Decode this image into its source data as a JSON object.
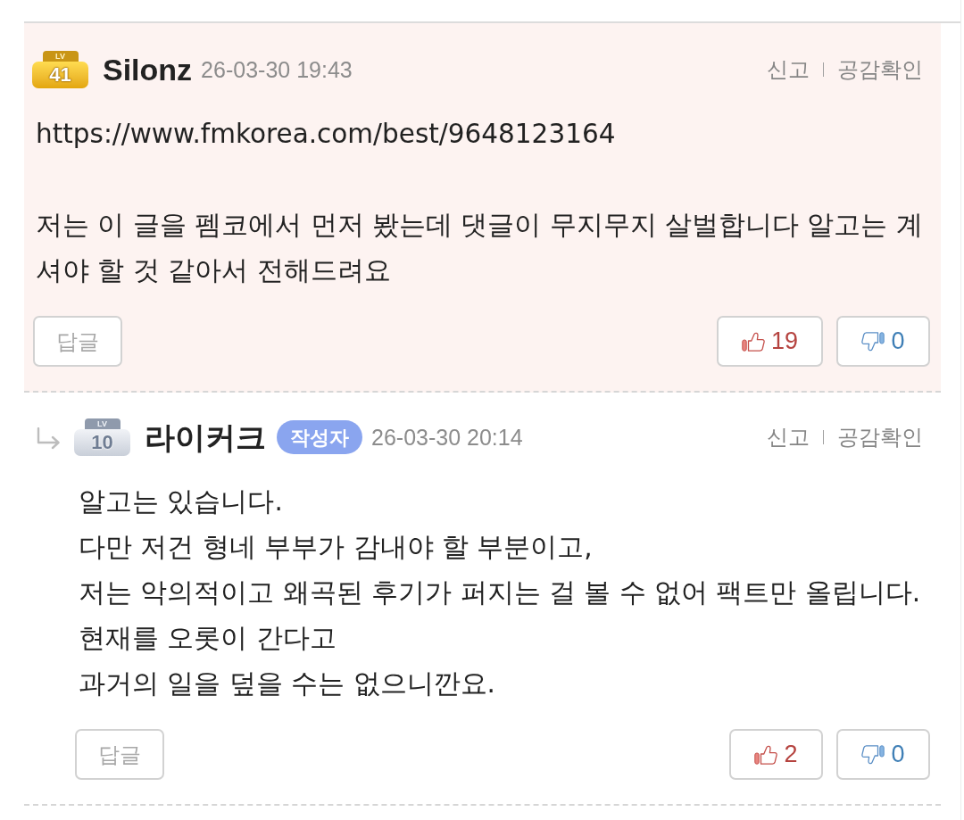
{
  "comments": [
    {
      "highlighted": true,
      "reply": false,
      "level": {
        "label": "LV",
        "number": "41",
        "kind": "gold"
      },
      "author": "Silonz",
      "date": "26-03-30 19:43",
      "actions": [
        "신고",
        "공감확인"
      ],
      "paragraphs": [
        [
          "https://www.fmkorea.com/best/9648123164"
        ],
        [
          "저는 이 글을 펨코에서 먼저 봤는데 댓글이 무지무지 살벌합니다 알고는 계셔야 할 것 같아서 전해드려요"
        ]
      ],
      "reply_button": "답글",
      "likes": "19",
      "dislikes": "0"
    },
    {
      "highlighted": false,
      "reply": true,
      "level": {
        "label": "LV",
        "number": "10",
        "kind": "silver"
      },
      "author": "라이커크",
      "author_badge": "작성자",
      "date": "26-03-30 20:14",
      "actions": [
        "신고",
        "공감확인"
      ],
      "paragraphs": [
        [
          "알고는 있습니다.",
          "다만 저건 형네 부부가 감내야 할 부분이고,",
          "저는 악의적이고 왜곡된 후기가 퍼지는 걸 볼 수 없어 팩트만 올립니다.",
          "현재를 오롯이 간다고",
          "과거의 일을 덮을 수는 없으니깐요."
        ]
      ],
      "reply_button": "답글",
      "likes": "2",
      "dislikes": "0"
    }
  ]
}
